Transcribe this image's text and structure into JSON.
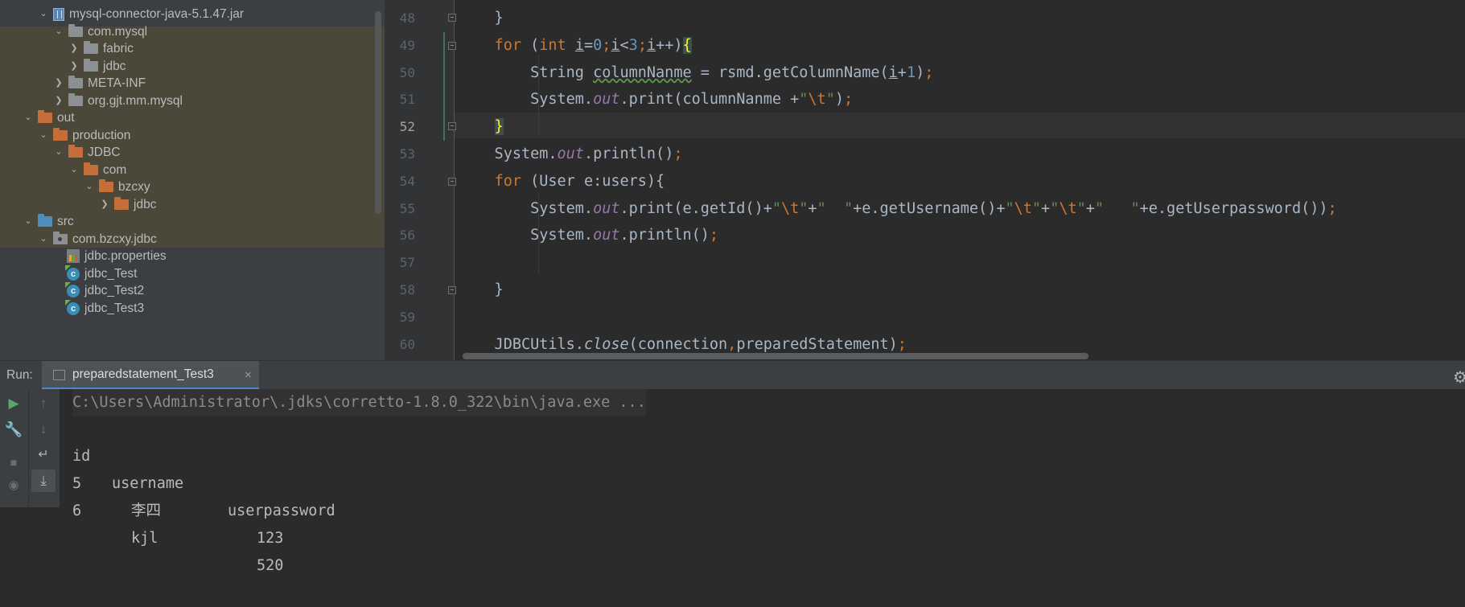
{
  "project_tree": {
    "items": [
      {
        "label": "mysql-connector-java-5.1.47.jar",
        "icon": "jar-icon",
        "arrow": "expanded"
      },
      {
        "label": "com.mysql",
        "icon": "folder-icon",
        "arrow": "expanded"
      },
      {
        "label": "fabric",
        "icon": "folder-icon",
        "arrow": "collapsed"
      },
      {
        "label": "jdbc",
        "icon": "folder-icon",
        "arrow": "collapsed"
      },
      {
        "label": "META-INF",
        "icon": "folder-icon",
        "arrow": "collapsed"
      },
      {
        "label": "org.gjt.mm.mysql",
        "icon": "folder-icon",
        "arrow": "collapsed"
      },
      {
        "label": "out",
        "icon": "folder-orange-icon",
        "arrow": "expanded"
      },
      {
        "label": "production",
        "icon": "folder-orange-icon",
        "arrow": "expanded"
      },
      {
        "label": "JDBC",
        "icon": "folder-orange-icon",
        "arrow": "expanded"
      },
      {
        "label": "com",
        "icon": "folder-orange-icon",
        "arrow": "expanded"
      },
      {
        "label": "bzcxy",
        "icon": "folder-orange-icon",
        "arrow": "expanded"
      },
      {
        "label": "jdbc",
        "icon": "folder-orange-icon",
        "arrow": "collapsed"
      },
      {
        "label": "src",
        "icon": "source-folder-icon",
        "arrow": "expanded"
      },
      {
        "label": "com.bzcxy.jdbc",
        "icon": "package-icon",
        "arrow": "expanded"
      },
      {
        "label": "jdbc.properties",
        "icon": "properties-file-icon",
        "arrow": "none"
      },
      {
        "label": "jdbc_Test",
        "icon": "java-class-icon",
        "arrow": "none"
      },
      {
        "label": "jdbc_Test2",
        "icon": "java-class-icon",
        "arrow": "none"
      },
      {
        "label": "jdbc_Test3",
        "icon": "java-class-icon",
        "arrow": "none"
      }
    ]
  },
  "editor": {
    "line_numbers": [
      "48",
      "49",
      "50",
      "51",
      "52",
      "53",
      "54",
      "55",
      "56",
      "57",
      "58",
      "59",
      "60"
    ],
    "active_line": "52"
  },
  "run_panel": {
    "label": "Run:",
    "tab_title": "preparedstatement_Test3",
    "tab_close": "×",
    "console": {
      "command": "C:\\Users\\Administrator\\.jdks\\corretto-1.8.0_322\\bin\\java.exe ...",
      "headers": [
        "id",
        "username",
        "userpassword"
      ],
      "rows": [
        [
          "5",
          "李四",
          "123"
        ],
        [
          "6",
          "kjl",
          "520"
        ]
      ]
    }
  },
  "colors": {
    "keyword": "#cc7832",
    "number": "#6897bb",
    "string": "#6a8759",
    "static_field": "#9876aa",
    "selection_highlight": "#4b4739"
  }
}
